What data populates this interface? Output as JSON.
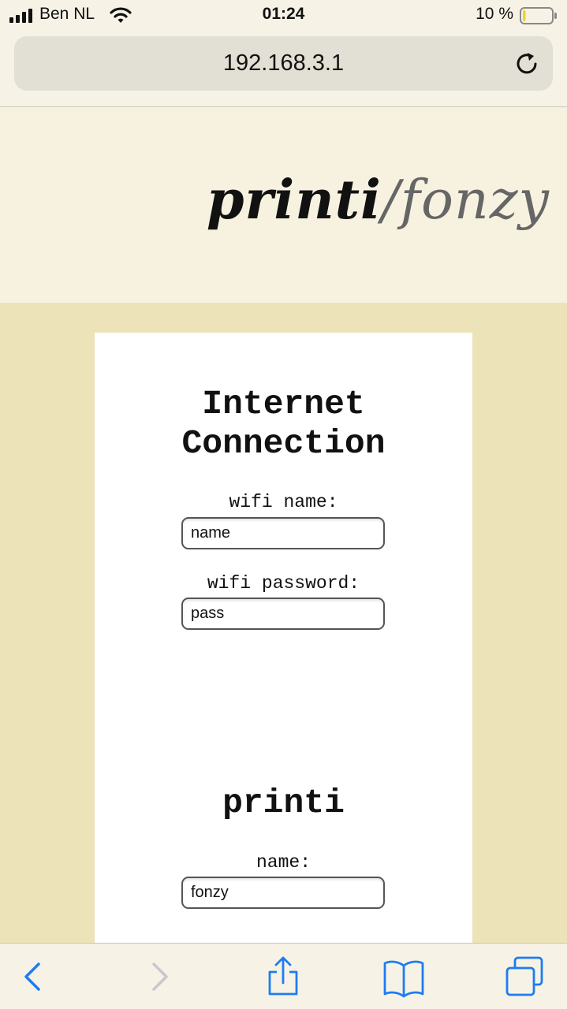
{
  "status_bar": {
    "carrier": "Ben NL",
    "time": "01:24",
    "battery_percent": "10 %",
    "battery_level": 0.1,
    "signal_icon": "signal-bars-icon",
    "wifi_icon": "wifi-icon",
    "battery_icon": "battery-low-icon"
  },
  "browser": {
    "url": "192.168.3.1",
    "reload_icon": "reload-icon"
  },
  "page": {
    "logo_primary": "printi",
    "logo_secondary": "/fonzy",
    "sections": {
      "internet": {
        "title_line1": "Internet",
        "title_line2": "Connection",
        "wifi_name_label": "wifi name:",
        "wifi_name_value": "name",
        "wifi_password_label": "wifi password:",
        "wifi_password_value": "pass"
      },
      "printi": {
        "title": "printi",
        "name_label": "name:",
        "name_value": "fonzy"
      }
    }
  },
  "toolbar": {
    "back_icon": "back-chevron-icon",
    "forward_icon": "forward-chevron-icon",
    "share_icon": "share-icon",
    "bookmarks_icon": "book-icon",
    "tabs_icon": "tabs-icon"
  },
  "colors": {
    "page_background": "#ece4b8",
    "header_background": "#f7f2e0",
    "ios_blue": "#1e7cf2",
    "battery_yellow": "#f2d22a"
  }
}
